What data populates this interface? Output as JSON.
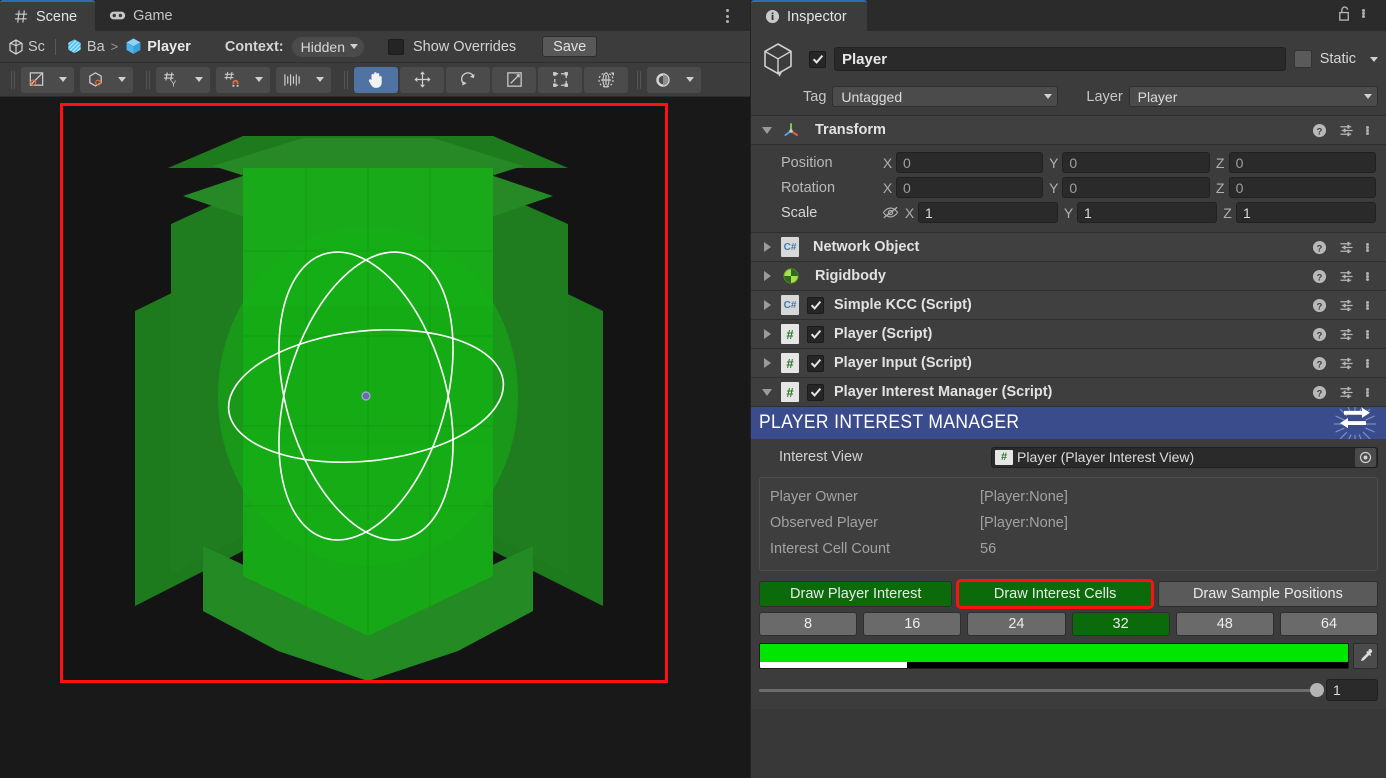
{
  "scene_panel": {
    "tabs": [
      {
        "label": "Scene",
        "icon": "grid-hash-icon",
        "active": true
      },
      {
        "label": "Game",
        "icon": "gamepad-icon",
        "active": false
      }
    ],
    "overflow_menu": "kebab-menu-icon",
    "breadcrumb": {
      "root": "Sc",
      "parent": "Ba",
      "separator": ">",
      "current": "Player"
    },
    "context": {
      "label": "Context:",
      "value": "Hidden"
    },
    "show_overrides": {
      "label": "Show Overrides",
      "checked": false
    },
    "save_button": "Save",
    "toolbar": [
      {
        "name": "draw-mode-shaded-icon",
        "type": "dropdown-button"
      },
      {
        "name": "2d-3d-toggle-icon",
        "type": "dropdown-button"
      },
      {
        "name": "grid-visibility-icon",
        "type": "dropdown-button"
      },
      {
        "name": "grid-snapping-icon",
        "type": "dropdown-button"
      },
      {
        "name": "snap-increment-icon",
        "type": "dropdown-button"
      },
      {
        "name": "hand-tool-icon",
        "type": "toggle",
        "active": true
      },
      {
        "name": "move-tool-icon",
        "type": "toggle",
        "active": false
      },
      {
        "name": "rotate-tool-icon",
        "type": "toggle",
        "active": false
      },
      {
        "name": "scale-tool-icon",
        "type": "toggle",
        "active": false
      },
      {
        "name": "rect-tool-icon",
        "type": "toggle",
        "active": false
      },
      {
        "name": "transform-tool-icon",
        "type": "toggle",
        "active": false
      },
      {
        "name": "custom-editor-tool-icon",
        "type": "dropdown-button"
      }
    ],
    "viewport": {
      "selection_outline_color": "#ff1111",
      "background_color": "#141414",
      "gizmo_interest_color": "#00c000",
      "pivot_dot_color": "#6a6ab0"
    }
  },
  "inspector": {
    "tab_label": "Inspector",
    "tab_icon": "info-icon",
    "lock_icon": "padlock-open-icon",
    "menu_icon": "kebab-menu-icon",
    "object_header": {
      "icon": "prefab-cube-icon",
      "enabled": true,
      "name": "Player",
      "static_label": "Static",
      "static_checked": false,
      "tag_label": "Tag",
      "tag_value": "Untagged",
      "layer_label": "Layer",
      "layer_value": "Player"
    },
    "transform": {
      "title": "Transform",
      "icon": "transform-axes-icon",
      "expanded": true,
      "rows": [
        {
          "label": "Position",
          "editable": false,
          "x": "0",
          "y": "0",
          "z": "0",
          "has_eye": false
        },
        {
          "label": "Rotation",
          "editable": false,
          "x": "0",
          "y": "0",
          "z": "0",
          "has_eye": false
        },
        {
          "label": "Scale",
          "editable": true,
          "x": "1",
          "y": "1",
          "z": "1",
          "has_eye": true
        }
      ],
      "axis_labels": [
        "X",
        "Y",
        "Z"
      ]
    },
    "components": [
      {
        "title": "Network Object",
        "icon": "csharp-script-icon",
        "expanded": false,
        "has_checkbox": false,
        "checked": false
      },
      {
        "title": "Rigidbody",
        "icon": "rigidbody-icon",
        "expanded": false,
        "has_checkbox": false,
        "checked": false
      },
      {
        "title": "Simple KCC (Script)",
        "icon": "csharp-script-icon",
        "expanded": false,
        "has_checkbox": true,
        "checked": true
      },
      {
        "title": "Player (Script)",
        "icon": "hash-script-icon",
        "expanded": false,
        "has_checkbox": true,
        "checked": true
      },
      {
        "title": "Player Input (Script)",
        "icon": "hash-script-icon",
        "expanded": false,
        "has_checkbox": true,
        "checked": true
      },
      {
        "title": "Player Interest Manager (Script)",
        "icon": "hash-script-icon",
        "expanded": true,
        "has_checkbox": true,
        "checked": true
      }
    ],
    "component_row_icons": {
      "help": "help-question-icon",
      "preset": "preset-sliders-icon",
      "menu": "kebab-menu-icon"
    },
    "player_interest_manager": {
      "banner_title": "PLAYER INTEREST MANAGER",
      "banner_color": "#3b4c8c",
      "banner_icon": "two-way-arrows-icon",
      "interest_view": {
        "label": "Interest View",
        "value": "Player (Player Interest View)",
        "icon": "hash-script-icon",
        "picker_icon": "object-picker-icon"
      },
      "readonly_fields": [
        {
          "label": "Player Owner",
          "value": "[Player:None]"
        },
        {
          "label": "Observed Player",
          "value": "[Player:None]"
        },
        {
          "label": "Interest Cell Count",
          "value": "56"
        }
      ],
      "draw_buttons": [
        {
          "label": "Draw Player Interest",
          "active": true,
          "highlighted": false
        },
        {
          "label": "Draw Interest Cells",
          "active": true,
          "highlighted": true
        },
        {
          "label": "Draw Sample Positions",
          "active": false,
          "highlighted": false
        }
      ],
      "size_buttons": [
        {
          "label": "8",
          "active": false
        },
        {
          "label": "16",
          "active": false
        },
        {
          "label": "24",
          "active": false
        },
        {
          "label": "32",
          "active": true
        },
        {
          "label": "48",
          "active": false
        },
        {
          "label": "64",
          "active": false
        }
      ],
      "color_field": {
        "color": "#00e600",
        "alpha_percent": 25,
        "eyedropper_icon": "eyedropper-icon"
      },
      "slider": {
        "value": "1",
        "percent": 100
      }
    }
  }
}
